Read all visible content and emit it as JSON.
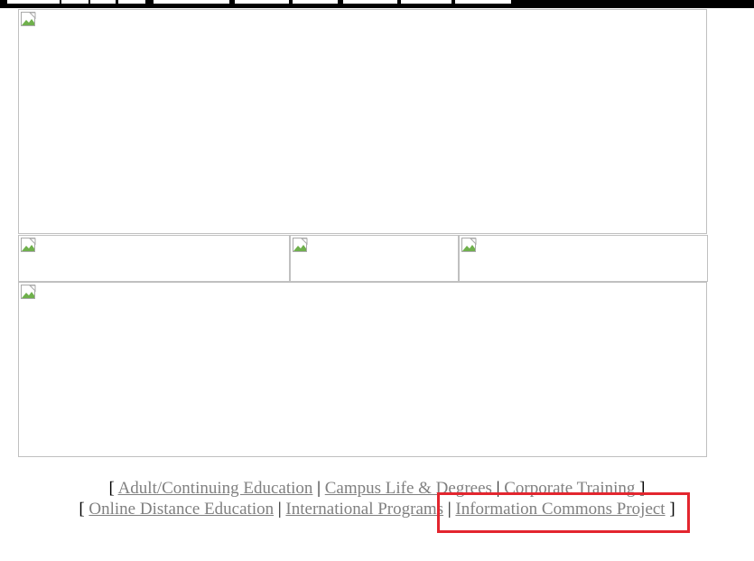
{
  "footer_nav": {
    "row1": {
      "open": "[",
      "sep": "|",
      "close": "]",
      "links": [
        "Adult/Continuing Education",
        "Campus Life & Degrees",
        "Corporate Training"
      ]
    },
    "row2": {
      "open": "[",
      "sep": "|",
      "close": "]",
      "links": [
        "Online Distance Education",
        "International Programs",
        "Information Commons Project"
      ]
    }
  },
  "colors": {
    "link": "#808080",
    "highlight": "#e3262f",
    "image_border": "#c0c0c0"
  }
}
